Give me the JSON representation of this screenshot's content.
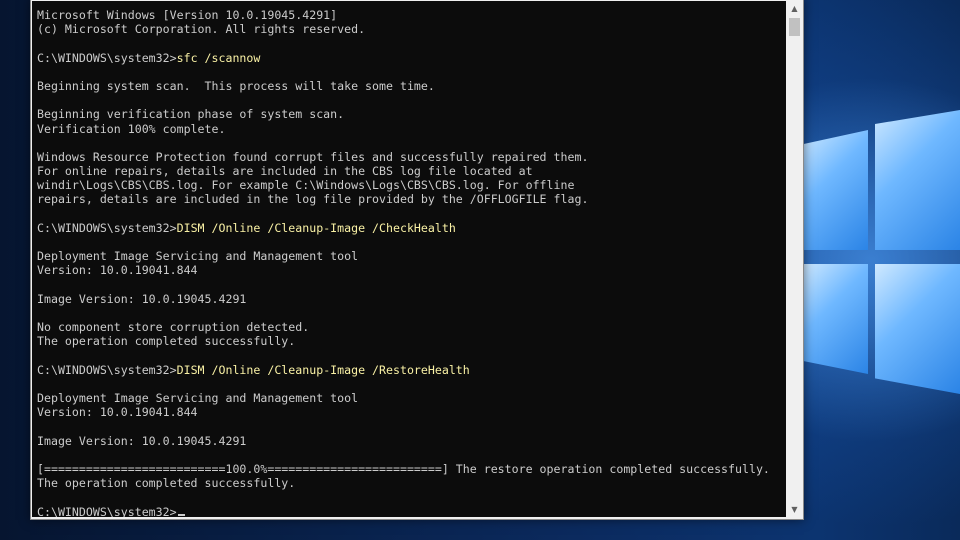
{
  "console": {
    "lines": [
      {
        "text": "Microsoft Windows [Version 10.0.19045.4291]"
      },
      {
        "text": "(c) Microsoft Corporation. All rights reserved."
      },
      {
        "text": ""
      },
      {
        "prompt": "C:\\WINDOWS\\system32>",
        "cmd": "sfc /scannow"
      },
      {
        "text": ""
      },
      {
        "text": "Beginning system scan.  This process will take some time."
      },
      {
        "text": ""
      },
      {
        "text": "Beginning verification phase of system scan."
      },
      {
        "text": "Verification 100% complete."
      },
      {
        "text": ""
      },
      {
        "text": "Windows Resource Protection found corrupt files and successfully repaired them."
      },
      {
        "text": "For online repairs, details are included in the CBS log file located at"
      },
      {
        "text": "windir\\Logs\\CBS\\CBS.log. For example C:\\Windows\\Logs\\CBS\\CBS.log. For offline"
      },
      {
        "text": "repairs, details are included in the log file provided by the /OFFLOGFILE flag."
      },
      {
        "text": ""
      },
      {
        "prompt": "C:\\WINDOWS\\system32>",
        "cmd": "DISM /Online /Cleanup-Image /CheckHealth"
      },
      {
        "text": ""
      },
      {
        "text": "Deployment Image Servicing and Management tool"
      },
      {
        "text": "Version: 10.0.19041.844"
      },
      {
        "text": ""
      },
      {
        "text": "Image Version: 10.0.19045.4291"
      },
      {
        "text": ""
      },
      {
        "text": "No component store corruption detected."
      },
      {
        "text": "The operation completed successfully."
      },
      {
        "text": ""
      },
      {
        "prompt": "C:\\WINDOWS\\system32>",
        "cmd": "DISM /Online /Cleanup-Image /RestoreHealth"
      },
      {
        "text": ""
      },
      {
        "text": "Deployment Image Servicing and Management tool"
      },
      {
        "text": "Version: 10.0.19041.844"
      },
      {
        "text": ""
      },
      {
        "text": "Image Version: 10.0.19045.4291"
      },
      {
        "text": ""
      },
      {
        "text": "[==========================100.0%=========================] The restore operation completed successfully."
      },
      {
        "text": "The operation completed successfully."
      },
      {
        "text": ""
      },
      {
        "prompt": "C:\\WINDOWS\\system32>",
        "cmd": "",
        "cursor": true
      }
    ]
  },
  "colors": {
    "console_bg": "#0c0c0c",
    "console_text": "#cccccc",
    "command_text": "#f9f1a5"
  },
  "icons": {
    "scroll_up": "scroll-up-arrow-icon",
    "scroll_down": "scroll-down-arrow-icon",
    "windows_logo": "windows-logo-icon"
  }
}
